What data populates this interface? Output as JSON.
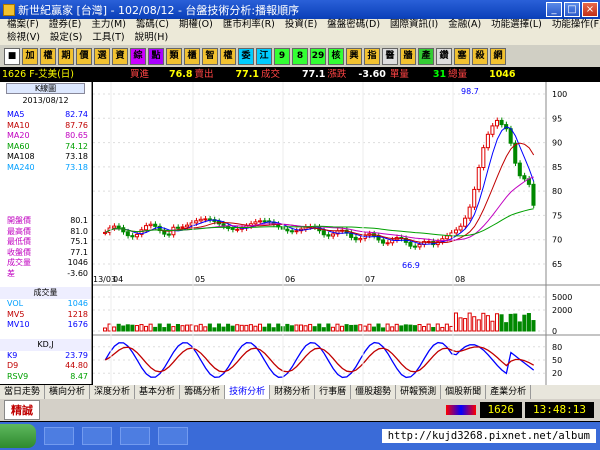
{
  "window": {
    "title": "新世紀贏家 [台灣] - 102/08/12 - 台盤技術分析:播報順序",
    "buttons": [
      "_",
      "□",
      "×"
    ]
  },
  "menu": {
    "row1": [
      "檔案(F)",
      "證券(E)",
      "主力(M)",
      "籌碼(C)",
      "期權(O)",
      "匯市利率(R)",
      "投資(E)",
      "盤盤密碼(D)",
      "國際資訊(I)",
      "金融(A)",
      "功能選擇(L)",
      "功能操作(F)"
    ],
    "row2": [
      "檢視(V)",
      "設定(S)",
      "工具(T)",
      "說明(H)"
    ]
  },
  "toolbar": {
    "buttons": [
      "■",
      "加",
      "權",
      "期",
      "價",
      "選",
      "資",
      "綜",
      "點",
      "類",
      "櫃",
      "智",
      "權",
      "委",
      "江",
      "9",
      "8",
      "29",
      "核",
      "興",
      "指",
      "醫",
      "牆",
      "產",
      "鑽",
      "塞",
      "殺",
      "網"
    ]
  },
  "info": {
    "code": "1626 F-艾美(日)",
    "bid_label": "買進",
    "bid": "76.8",
    "ask_label": "賣出",
    "ask": "77.1",
    "deal_label": "成交",
    "deal": "77.1",
    "chg_label": "漲跌",
    "chg": "-3.60",
    "vol_label": "單量",
    "vol": "31",
    "tvol_label": "總量",
    "tvol": "1046"
  },
  "left_panel": {
    "header": "K線圖",
    "date": "2013/08/12",
    "ma": [
      {
        "k": "MA5",
        "v": "82.74",
        "c": "#0000ff"
      },
      {
        "k": "MA10",
        "v": "87.76",
        "c": "#c00000"
      },
      {
        "k": "MA20",
        "v": "80.65",
        "c": "#c000c0"
      },
      {
        "k": "MA60",
        "v": "74.12",
        "c": "#00a000"
      },
      {
        "k": "MA108",
        "v": "73.18",
        "c": "#000000"
      },
      {
        "k": "MA240",
        "v": "73.18",
        "c": "#00a0ff"
      }
    ],
    "quote": [
      {
        "k": "開盤價",
        "v": "80.1"
      },
      {
        "k": "最高價",
        "v": "81.0"
      },
      {
        "k": "最低價",
        "v": "75.1"
      },
      {
        "k": "收盤價",
        "v": "77.1"
      },
      {
        "k": "成交量",
        "v": "1046"
      },
      {
        "k": "差",
        "v": "-3.60"
      }
    ],
    "vol_header": "成交量",
    "vol": [
      {
        "k": "VOL",
        "v": "1046",
        "c": "#00a0ff"
      },
      {
        "k": "MV5",
        "v": "1218",
        "c": "#c00000"
      },
      {
        "k": "MV10",
        "v": "1676",
        "c": "#0000ff"
      }
    ],
    "kd_header": "KD,J",
    "kd": [
      {
        "k": "K9",
        "v": "23.79",
        "c": "#0000ff"
      },
      {
        "k": "D9",
        "v": "44.80",
        "c": "#c00000"
      },
      {
        "k": "RSV9",
        "v": "8.47",
        "c": "#00a000"
      }
    ]
  },
  "chart_data": {
    "type": "candlestick",
    "x_ticks": [
      "13/03",
      "04",
      "05",
      "06",
      "07",
      "08"
    ],
    "price_axis": [
      "100",
      "95",
      "90",
      "85",
      "80",
      "75",
      "70",
      "65"
    ],
    "high_mark": "98.7",
    "low_mark": "66.9",
    "vol_axis": [
      "5000",
      "2000",
      "0"
    ],
    "kd_axis": [
      "80",
      "50",
      "20"
    ]
  },
  "tabs": [
    "當日走勢",
    "橫向分析",
    "深度分析",
    "基本分析",
    "籌碼分析",
    "技術分析",
    "財務分析",
    "行事曆",
    "僵股趨勢",
    "研報預測",
    "個股新聞",
    "產業分析"
  ],
  "status": {
    "label": "精誠",
    "code": "1626",
    "time": "13:48:13"
  },
  "taskbar": {
    "url": "http://kujd3268.pixnet.net/album"
  }
}
